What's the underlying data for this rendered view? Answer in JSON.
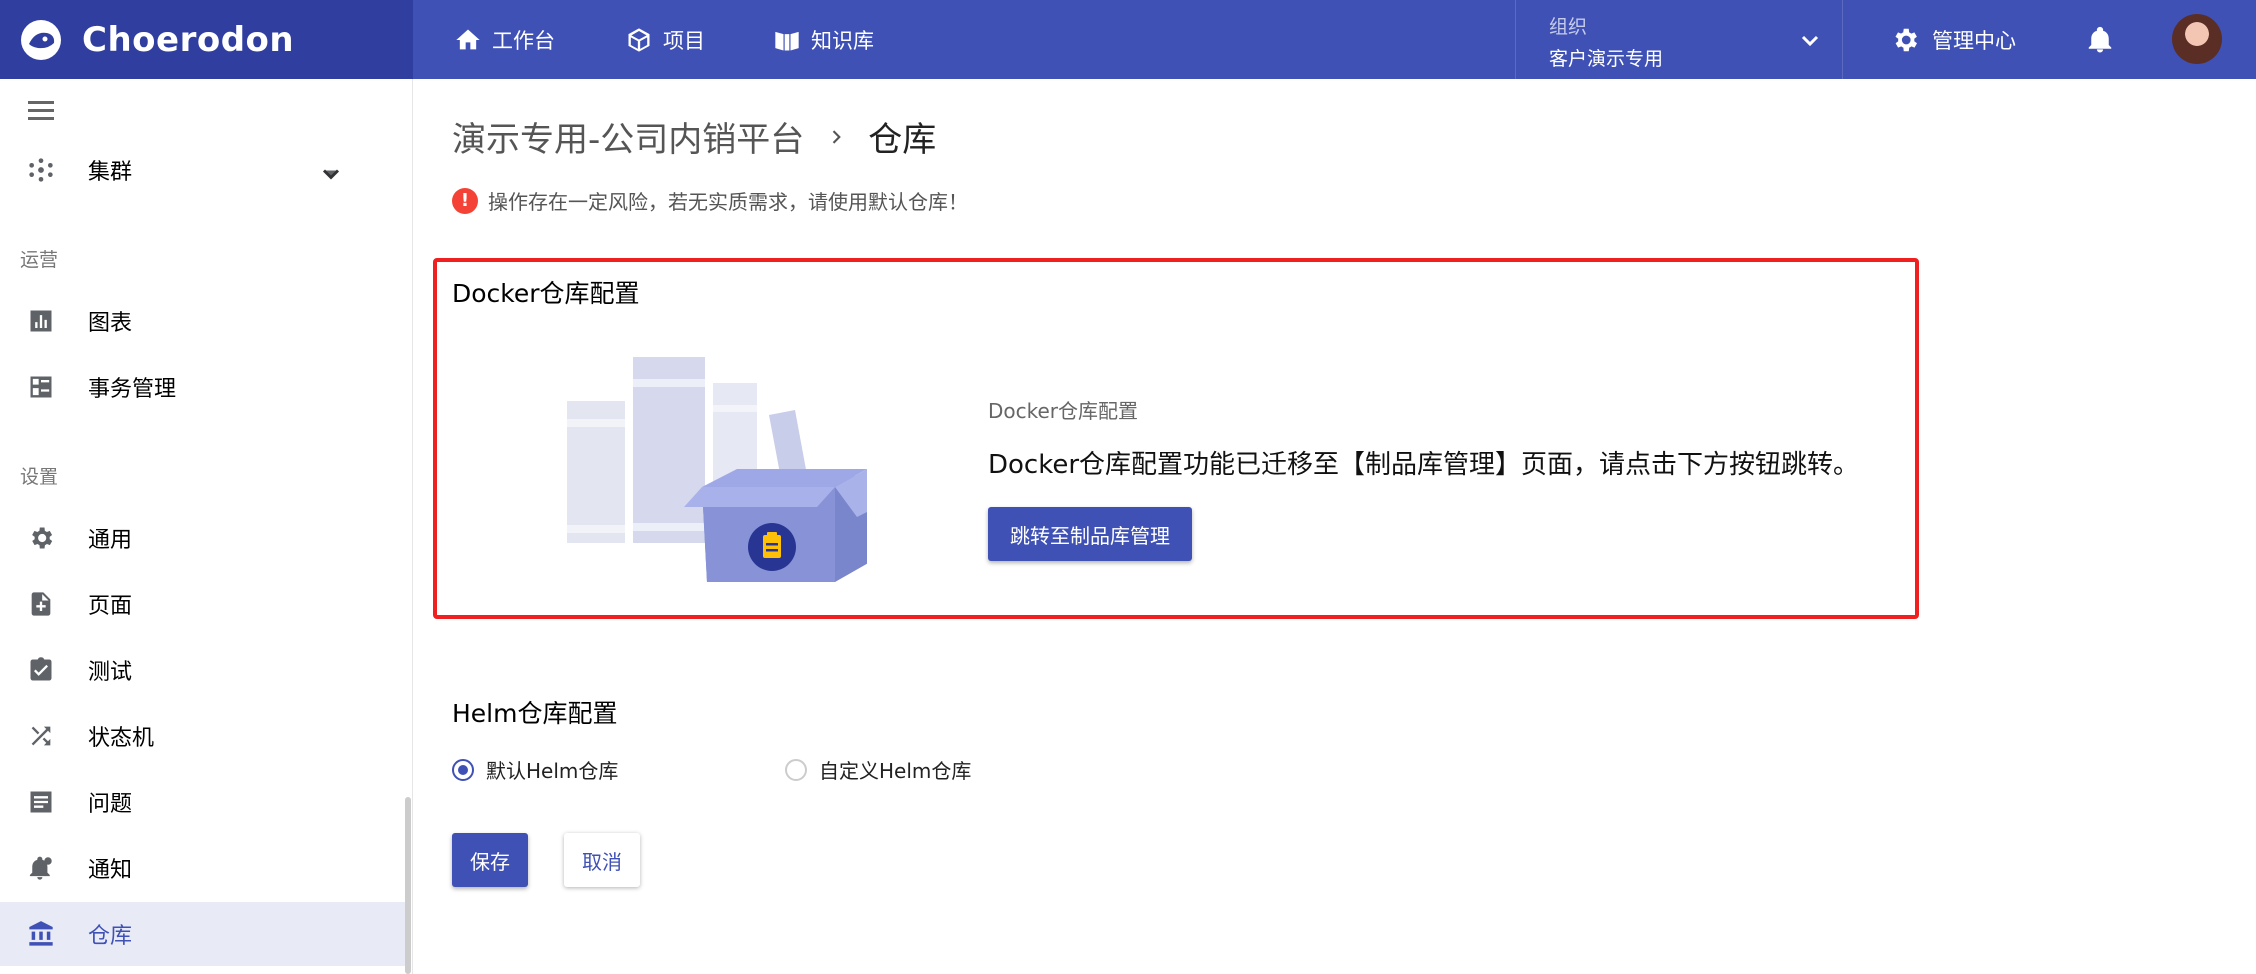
{
  "header": {
    "brand": "Choerodon",
    "nav": [
      {
        "label": "工作台",
        "icon": "home-icon"
      },
      {
        "label": "项目",
        "icon": "cube-icon"
      },
      {
        "label": "知识库",
        "icon": "book-icon"
      }
    ],
    "org": {
      "label": "组织",
      "value": "客户演示专用"
    },
    "admin_label": "管理中心"
  },
  "sidebar": {
    "items": [
      {
        "label": "集群",
        "icon": "cluster-icon"
      },
      {
        "label": "图表",
        "icon": "chart-icon"
      },
      {
        "label": "事务管理",
        "icon": "task-board-icon"
      },
      {
        "label": "通用",
        "icon": "gear-icon"
      },
      {
        "label": "页面",
        "icon": "page-add-icon"
      },
      {
        "label": "测试",
        "icon": "clipboard-check-icon"
      },
      {
        "label": "状态机",
        "icon": "shuffle-icon"
      },
      {
        "label": "问题",
        "icon": "list-icon"
      },
      {
        "label": "通知",
        "icon": "notification-icon"
      },
      {
        "label": "仓库",
        "icon": "bank-icon"
      }
    ],
    "groups": {
      "ops": "运营",
      "settings": "设置"
    },
    "active": "仓库"
  },
  "main": {
    "breadcrumb": {
      "parent": "演示专用-公司内销平台",
      "current": "仓库"
    },
    "warning": "操作存在一定风险，若无实质需求，请使用默认仓库！",
    "docker": {
      "title": "Docker仓库配置",
      "subtitle": "Docker仓库配置",
      "description": "Docker仓库配置功能已迁移至【制品库管理】页面，请点击下方按钮跳转。",
      "button": "跳转至制品库管理"
    },
    "helm": {
      "title": "Helm仓库配置",
      "options": [
        {
          "label": "默认Helm仓库",
          "checked": true
        },
        {
          "label": "自定义Helm仓库",
          "checked": false
        }
      ]
    },
    "save": "保存",
    "cancel": "取消"
  },
  "colors": {
    "primary": "#3f51b5",
    "header_dark": "#303f9f",
    "highlight_border": "#f02020",
    "warning": "#f44336"
  }
}
